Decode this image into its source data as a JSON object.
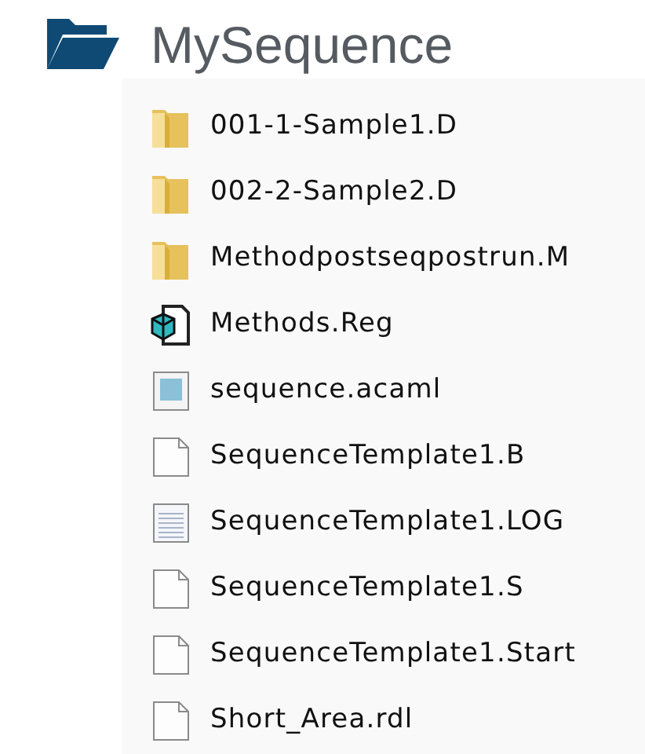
{
  "folder": {
    "title": "MySequence"
  },
  "files": [
    {
      "name": "001-1-Sample1.D",
      "kind": "folder"
    },
    {
      "name": "002-2-Sample2.D",
      "kind": "folder"
    },
    {
      "name": "Methodpostseqpostrun.M",
      "kind": "folder"
    },
    {
      "name": "Methods.Reg",
      "kind": "registry"
    },
    {
      "name": "sequence.acaml",
      "kind": "document"
    },
    {
      "name": "SequenceTemplate1.B",
      "kind": "blank"
    },
    {
      "name": "SequenceTemplate1.LOG",
      "kind": "text"
    },
    {
      "name": "SequenceTemplate1.S",
      "kind": "blank"
    },
    {
      "name": "SequenceTemplate1.Start",
      "kind": "blank"
    },
    {
      "name": "Short_Area.rdl",
      "kind": "blank"
    }
  ]
}
